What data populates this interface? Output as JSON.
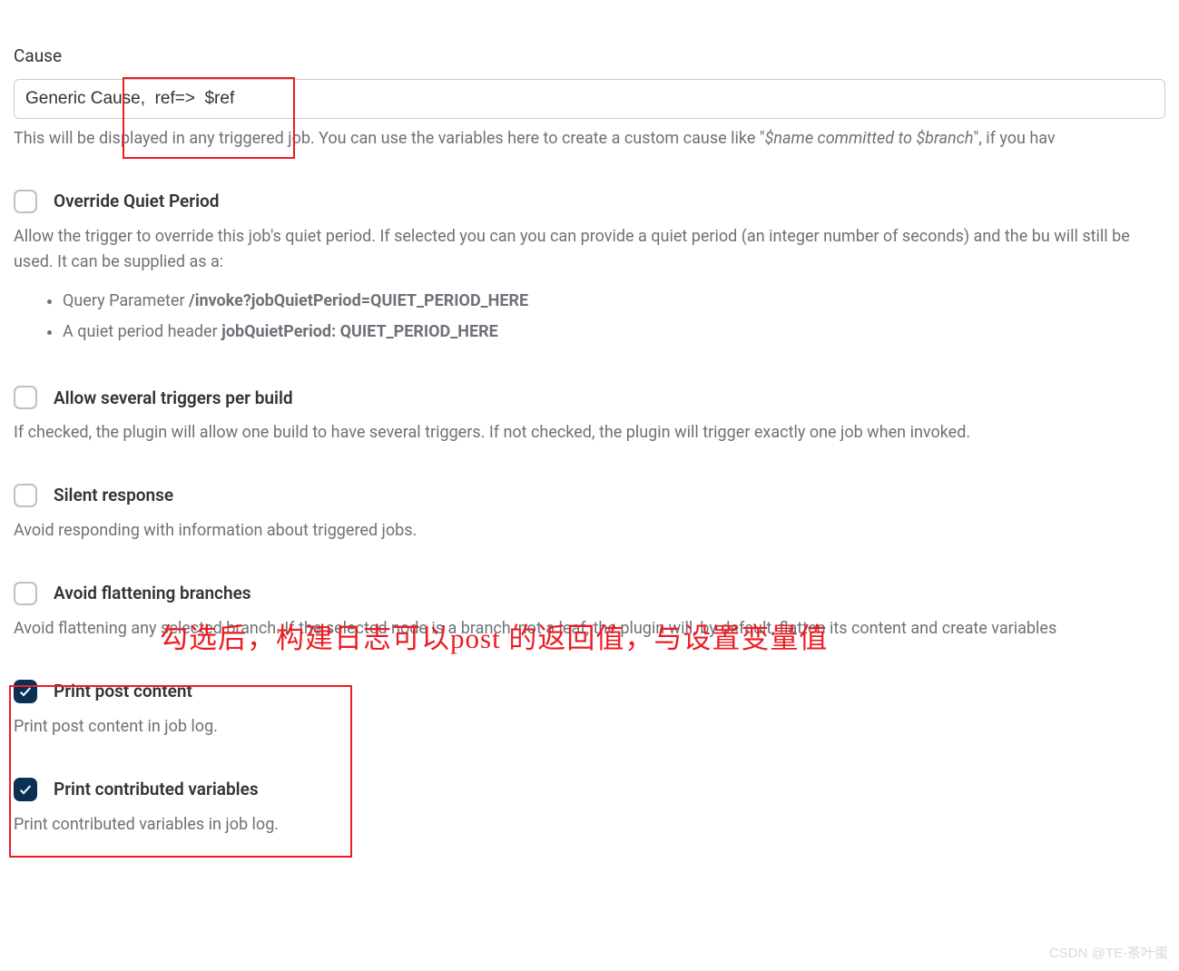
{
  "cause": {
    "label": "Cause",
    "value": "Generic Cause,  ref=>  $ref",
    "help_prefix": "This will be displayed in any triggered job. You can use the variables here to create a custom cause like \"",
    "help_italic": "$name committed to $branch",
    "help_suffix": "\", if you hav"
  },
  "overrideQuiet": {
    "label": "Override Quiet Period",
    "help": "Allow the trigger to override this job's quiet period. If selected you can you can provide a quiet period (an integer number of seconds) and the bu will still be used. It can be supplied as a:",
    "bullets": [
      {
        "prefix": "Query Parameter ",
        "bold": "/invoke?jobQuietPeriod=QUIET_PERIOD_HERE"
      },
      {
        "prefix": "A quiet period header ",
        "bold": "jobQuietPeriod: QUIET_PERIOD_HERE"
      }
    ]
  },
  "allowSeveral": {
    "label": "Allow several triggers per build",
    "help": "If checked, the plugin will allow one build to have several triggers. If not checked, the plugin will trigger exactly one job when invoked."
  },
  "silentResponse": {
    "label": "Silent response",
    "help": "Avoid responding with information about triggered jobs."
  },
  "avoidFlatten": {
    "label": "Avoid flattening branches",
    "help": "Avoid flattening any selected branch. If the selected node is a branch, not a leaf, the plugin will, by default, flatten its content and create variables"
  },
  "printPost": {
    "label": "Print post content",
    "help": "Print post content in job log."
  },
  "printVars": {
    "label": "Print contributed variables",
    "help": "Print contributed variables in job log."
  },
  "annotation": "勾选后，构建日志可以post 的返回值，与设置变量值",
  "watermark": "CSDN @TE-茶叶蛋"
}
